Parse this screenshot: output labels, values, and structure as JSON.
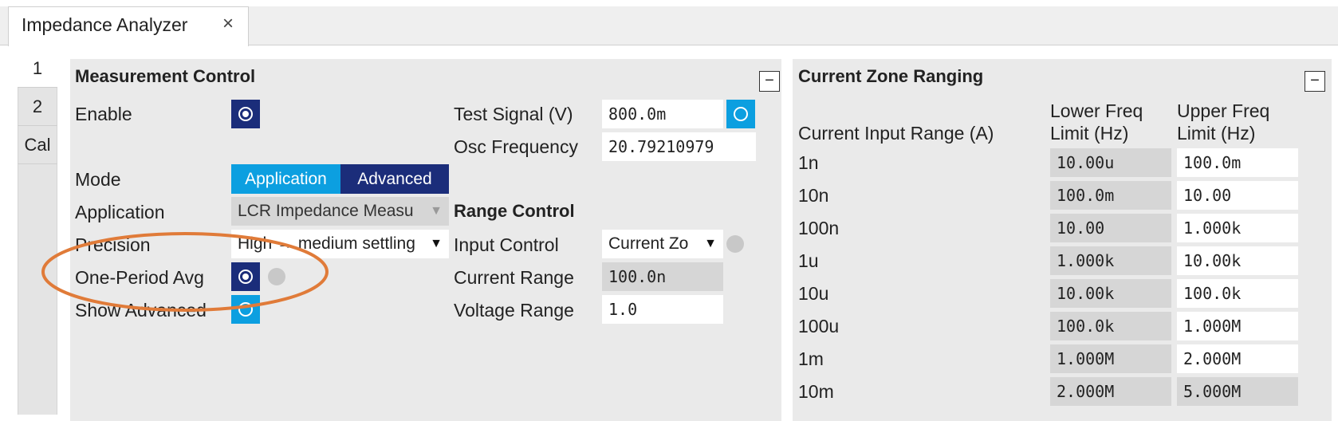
{
  "window": {
    "tab_title": "Impedance Analyzer",
    "close_glyph": "×"
  },
  "side_tabs": [
    "1",
    "2",
    "Cal"
  ],
  "measurement_control": {
    "title": "Measurement Control",
    "minimize_glyph": "−",
    "enable_label": "Enable",
    "mode_label": "Mode",
    "mode_options": [
      "Application",
      "Advanced"
    ],
    "application_label": "Application",
    "application_value": "LCR Impedance Measu",
    "precision_label": "Precision",
    "precision_value": "High → medium settling",
    "one_period_avg_label": "One-Period Avg",
    "show_advanced_label": "Show Advanced",
    "test_signal_label": "Test Signal (V)",
    "test_signal_value": "800.0m",
    "osc_frequency_label": "Osc Frequency",
    "osc_frequency_value": "20.79210979",
    "range_control_title": "Range Control",
    "input_control_label": "Input Control",
    "input_control_value": "Current Zo",
    "current_range_label": "Current Range",
    "current_range_value": "100.0n",
    "voltage_range_label": "Voltage Range",
    "voltage_range_value": "1.0",
    "dropdown_arrow": "▼"
  },
  "current_zone": {
    "title": "Current Zone Ranging",
    "minimize_glyph": "−",
    "col_range": "Current Input Range (A)",
    "col_lower_1": "Lower Freq",
    "col_lower_2": "Limit (Hz)",
    "col_upper_1": "Upper Freq",
    "col_upper_2": "Limit (Hz)",
    "rows": [
      {
        "range": "1n",
        "lower": "10.00u",
        "upper": "100.0m"
      },
      {
        "range": "10n",
        "lower": "100.0m",
        "upper": "10.00"
      },
      {
        "range": "100n",
        "lower": "10.00",
        "upper": "1.000k"
      },
      {
        "range": "1u",
        "lower": "1.000k",
        "upper": "10.00k"
      },
      {
        "range": "10u",
        "lower": "10.00k",
        "upper": "100.0k"
      },
      {
        "range": "100u",
        "lower": "100.0k",
        "upper": "1.000M"
      },
      {
        "range": "1m",
        "lower": "1.000M",
        "upper": "2.000M"
      },
      {
        "range": "10m",
        "lower": "2.000M",
        "upper": "5.000M"
      }
    ]
  },
  "colors": {
    "accent_dark": "#1b2d7a",
    "accent_light": "#0c9fe0",
    "annotation": "#e07b39"
  }
}
